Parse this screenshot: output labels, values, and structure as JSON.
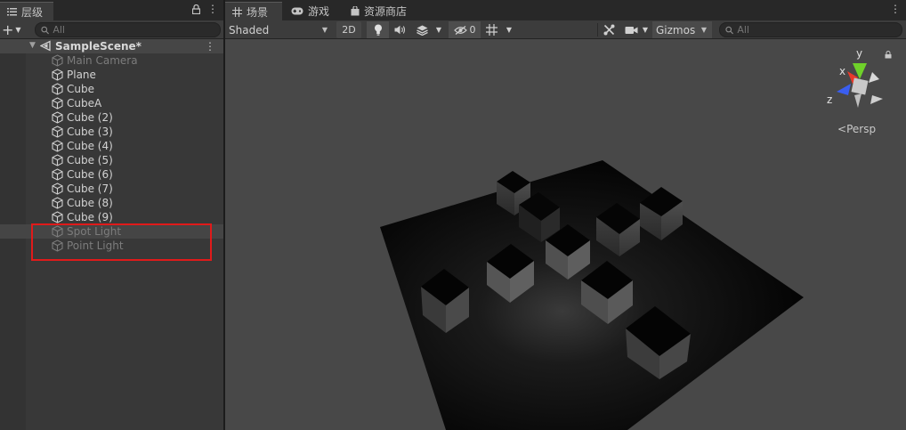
{
  "hierarchy": {
    "tab_label": "层级",
    "search_placeholder": "All",
    "scene_name": "SampleScene*",
    "items": [
      {
        "label": "Main Camera",
        "disabled": true
      },
      {
        "label": "Plane",
        "disabled": false
      },
      {
        "label": "Cube",
        "disabled": false
      },
      {
        "label": "CubeA",
        "disabled": false
      },
      {
        "label": "Cube (2)",
        "disabled": false
      },
      {
        "label": "Cube (3)",
        "disabled": false
      },
      {
        "label": "Cube (4)",
        "disabled": false
      },
      {
        "label": "Cube (5)",
        "disabled": false
      },
      {
        "label": "Cube (6)",
        "disabled": false
      },
      {
        "label": "Cube (7)",
        "disabled": false
      },
      {
        "label": "Cube (8)",
        "disabled": false
      },
      {
        "label": "Cube (9)",
        "disabled": false
      },
      {
        "label": "Spot Light",
        "disabled": true
      },
      {
        "label": "Point Light",
        "disabled": true
      }
    ]
  },
  "scene_tabs": {
    "scene": "场景",
    "game": "游戏",
    "asset_store": "资源商店"
  },
  "scene_toolbar": {
    "shading_mode": "Shaded",
    "mode_2d": "2D",
    "hidden_count": "0",
    "gizmos": "Gizmos",
    "search_placeholder": "All"
  },
  "gizmo": {
    "x_label": "x",
    "y_label": "y",
    "z_label": "z",
    "projection": "Persp",
    "colors": {
      "x": "#e83a2b",
      "y": "#6fd12a",
      "z": "#3a5ef0"
    }
  },
  "colors": {
    "highlight_box": "#e01a1a",
    "panel_bg": "#383838",
    "viewport_bg": "#484848"
  }
}
